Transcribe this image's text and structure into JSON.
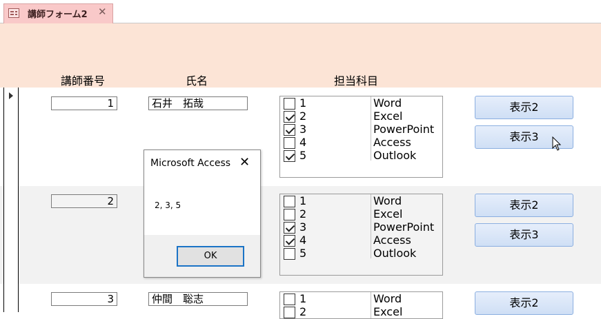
{
  "tab": {
    "title": "講師フォーム2",
    "close": "✕"
  },
  "header": {
    "id_label": "講師番号",
    "name_label": "氏名",
    "subjects_label": "担当科目"
  },
  "records": [
    {
      "id": "1",
      "name": "石井　拓哉",
      "subjects": [
        {
          "num": "1",
          "name": "Word",
          "checked": false
        },
        {
          "num": "2",
          "name": "Excel",
          "checked": true
        },
        {
          "num": "3",
          "name": "PowerPoint",
          "checked": true
        },
        {
          "num": "4",
          "name": "Access",
          "checked": false
        },
        {
          "num": "5",
          "name": "Outlook",
          "checked": true
        }
      ],
      "btn2": "表示2",
      "btn3": "表示3"
    },
    {
      "id": "2",
      "name": "",
      "subjects": [
        {
          "num": "1",
          "name": "Word",
          "checked": false
        },
        {
          "num": "2",
          "name": "Excel",
          "checked": false
        },
        {
          "num": "3",
          "name": "PowerPoint",
          "checked": true
        },
        {
          "num": "4",
          "name": "Access",
          "checked": true
        },
        {
          "num": "5",
          "name": "Outlook",
          "checked": false
        }
      ],
      "btn2": "表示2",
      "btn3": "表示3"
    },
    {
      "id": "3",
      "name": "仲間　聡志",
      "subjects": [
        {
          "num": "1",
          "name": "Word",
          "checked": false
        },
        {
          "num": "2",
          "name": "Excel",
          "checked": false
        }
      ],
      "btn2": "表示2"
    }
  ],
  "dialog": {
    "title": "Microsoft Access",
    "close": "✕",
    "message": "2, 3, 5",
    "ok": "OK"
  }
}
